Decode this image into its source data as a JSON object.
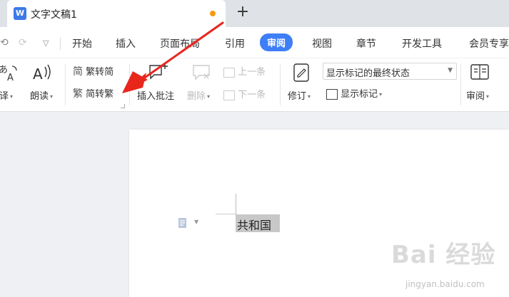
{
  "titlebar": {
    "doc_title": "文字文稿1",
    "doc_icon": "W",
    "new_tab": "+"
  },
  "ribbon_tabs": [
    "开始",
    "插入",
    "页面布局",
    "引用",
    "审阅",
    "视图",
    "章节",
    "开发工具",
    "会员专享"
  ],
  "active_tab": "审阅",
  "toolbar": {
    "translate_label": "翻译",
    "read_aloud_label": "朗读",
    "trad_to_simp": "繁转简",
    "simp_to_trad": "简转繁",
    "insert_comment": "插入批注",
    "delete": "删除",
    "prev_item": "上一条",
    "next_item": "下一条",
    "track_changes": "修订",
    "markup_dropdown_value": "显示标记的最终状态",
    "show_markup": "显示标记",
    "review": "审阅"
  },
  "document": {
    "selected_text": "共和国"
  },
  "watermark": {
    "main": "Bai 经验",
    "sub": "jingyan.baidu.com"
  },
  "colors": {
    "accent": "#3e7ef7",
    "arrow": "#e8261c",
    "unsaved_dot": "#f29a16"
  }
}
